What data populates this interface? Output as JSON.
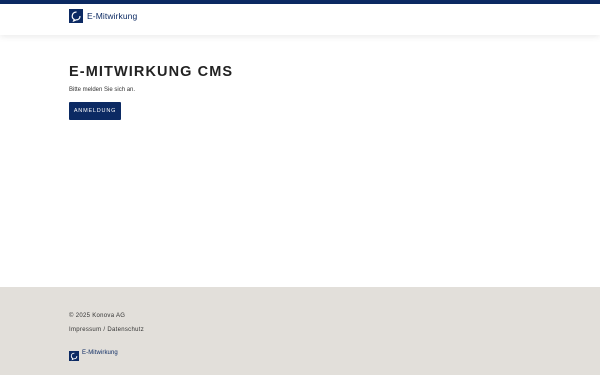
{
  "header": {
    "brand_name": "E-Mitwirkung",
    "logo_icon": "speech-bubble-logo-icon"
  },
  "main": {
    "title": "E-MITWIRKUNG CMS",
    "subtitle": "Bitte melden Sie sich an.",
    "login_button_label": "ANMELDUNG"
  },
  "footer": {
    "copyright": "© 2025 Konova AG",
    "links": [
      {
        "label": "Impressum"
      },
      {
        "label": "Datenschutz"
      }
    ],
    "separator": "/",
    "brand_name": "E-Mitwirkung"
  },
  "colors": {
    "brand_navy": "#0c2a63",
    "footer_bg": "#e2dfda",
    "page_bg": "#ffffff"
  }
}
